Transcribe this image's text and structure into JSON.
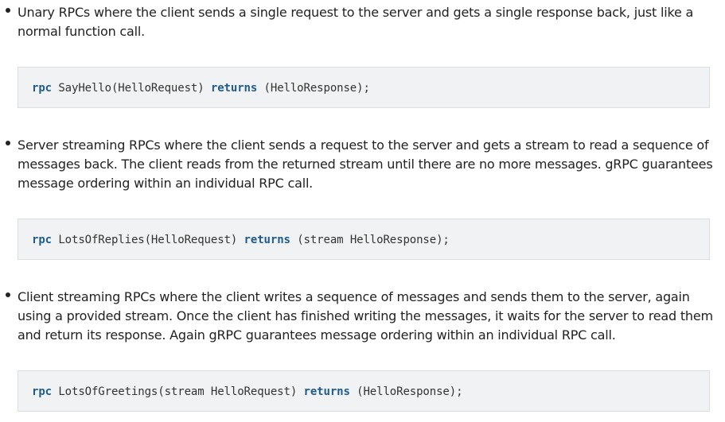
{
  "items": [
    {
      "text": "Unary RPCs where the client sends a single request to the server and gets a single response back, just like a normal function call.",
      "code": {
        "keyword1": "rpc",
        "part1": " SayHello(HelloRequest) ",
        "keyword2": "returns",
        "part2": " (HelloResponse);"
      }
    },
    {
      "text": "Server streaming RPCs where the client sends a request to the server and gets a stream to read a sequence of messages back. The client reads from the returned stream until there are no more messages. gRPC guarantees message ordering within an individual RPC call.",
      "code": {
        "keyword1": "rpc",
        "part1": " LotsOfReplies(HelloRequest) ",
        "keyword2": "returns",
        "part2": " (stream HelloResponse);"
      }
    },
    {
      "text": "Client streaming RPCs where the client writes a sequence of messages and sends them to the server, again using a provided stream. Once the client has finished writing the messages, it waits for the server to read them and return its response. Again gRPC guarantees message ordering within an individual RPC call.",
      "code": {
        "keyword1": "rpc",
        "part1": " LotsOfGreetings(stream HelloRequest) ",
        "keyword2": "returns",
        "part2": " (HelloResponse);"
      }
    }
  ]
}
